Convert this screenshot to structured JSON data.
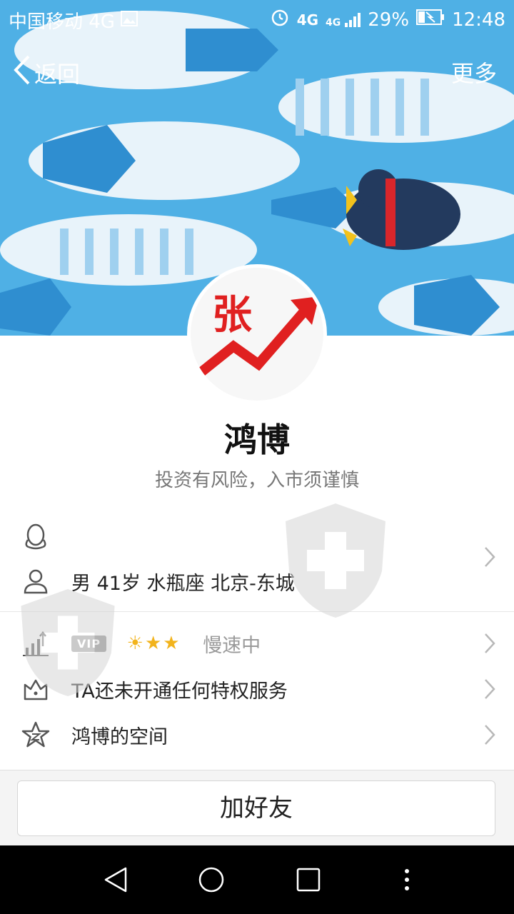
{
  "status_bar": {
    "carrier": "中国移动 4G",
    "network_labels": [
      "4G",
      "4G"
    ],
    "battery_percent": "29%",
    "time": "12:48"
  },
  "nav": {
    "back_label": "返回",
    "more_label": "更多"
  },
  "profile": {
    "avatar_char": "张",
    "name": "鸿博",
    "signature": "投资有风险，入市须谨慎",
    "qq_number": "",
    "info": "男  41岁  水瓶座  北京-东城"
  },
  "level_row": {
    "vip_label": "VIP",
    "stars": "☀★★",
    "speed_label": "慢速中"
  },
  "privilege_row": {
    "label": "TA还未开通任何特权服务"
  },
  "space_row": {
    "label": "鸿博的空间"
  },
  "action": {
    "add_friend_label": "加好友"
  },
  "icons": [
    "qq-icon",
    "person-icon",
    "level-icon",
    "crown-icon",
    "star-icon",
    "chevron-right-icon",
    "back-chevron-icon",
    "alarm-icon",
    "signal-icon",
    "battery-icon",
    "back-triangle-icon",
    "home-circle-icon",
    "recent-square-icon",
    "menu-dots-icon"
  ],
  "colors": {
    "banner": "#4fb0e5",
    "star": "#f2b31c",
    "avatar_arrow": "#e02020"
  }
}
